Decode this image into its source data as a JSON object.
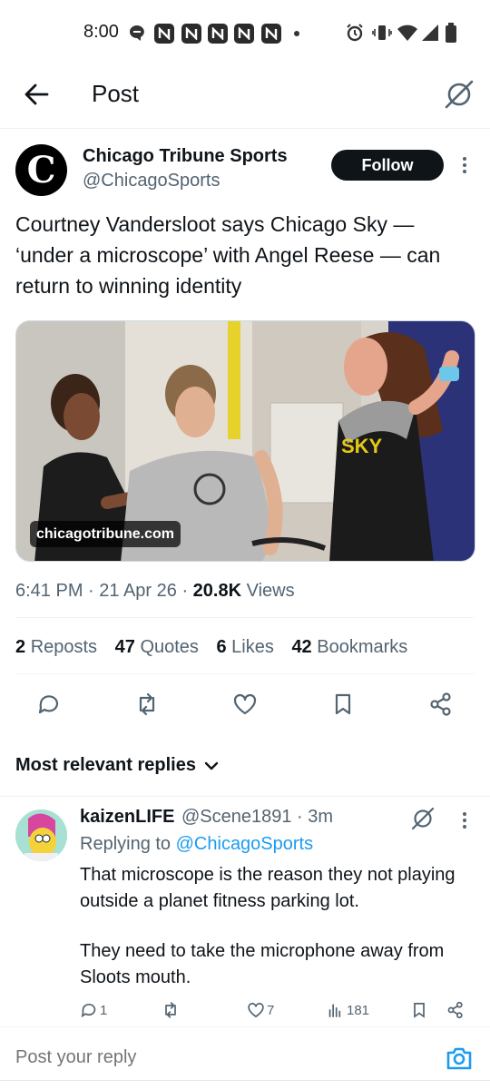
{
  "status_bar": {
    "time": "8:00"
  },
  "header": {
    "title": "Post"
  },
  "tweet": {
    "author_name": "Chicago Tribune Sports",
    "author_handle": "@ChicagoSports",
    "follow_label": "Follow",
    "text": "Courtney Vandersloot says Chicago Sky — ‘under a microscope’ with Angel Reese — can return to winning identity",
    "media_caption": "chicagotribune.com",
    "media_jersey_text": "SKY",
    "time": "6:41 PM",
    "date": "21 Apr 26",
    "views_count": "20.8K",
    "views_label": "Views",
    "stats": {
      "reposts_count": "2",
      "reposts_label": "Reposts",
      "quotes_count": "47",
      "quotes_label": "Quotes",
      "likes_count": "6",
      "likes_label": "Likes",
      "bookmarks_count": "42",
      "bookmarks_label": "Bookmarks"
    }
  },
  "replies_sort": {
    "label": "Most relevant replies"
  },
  "reply": {
    "name": "kaizenLIFE",
    "handle_time": "@Scene1891 · 3m",
    "replying_prefix": "Replying to",
    "replying_handle": "@ChicagoSports",
    "paragraph1": "That microscope is the reason they not playing outside a planet fitness parking lot.",
    "paragraph2": "They need to take the microphone away from Sloots mouth.",
    "replies_count": "1",
    "likes_count": "7",
    "views_count": "181"
  },
  "compose": {
    "placeholder": "Post your reply"
  },
  "colors": {
    "accent": "#1d9bf0",
    "text_primary": "#0f1419",
    "text_secondary": "#536471"
  }
}
